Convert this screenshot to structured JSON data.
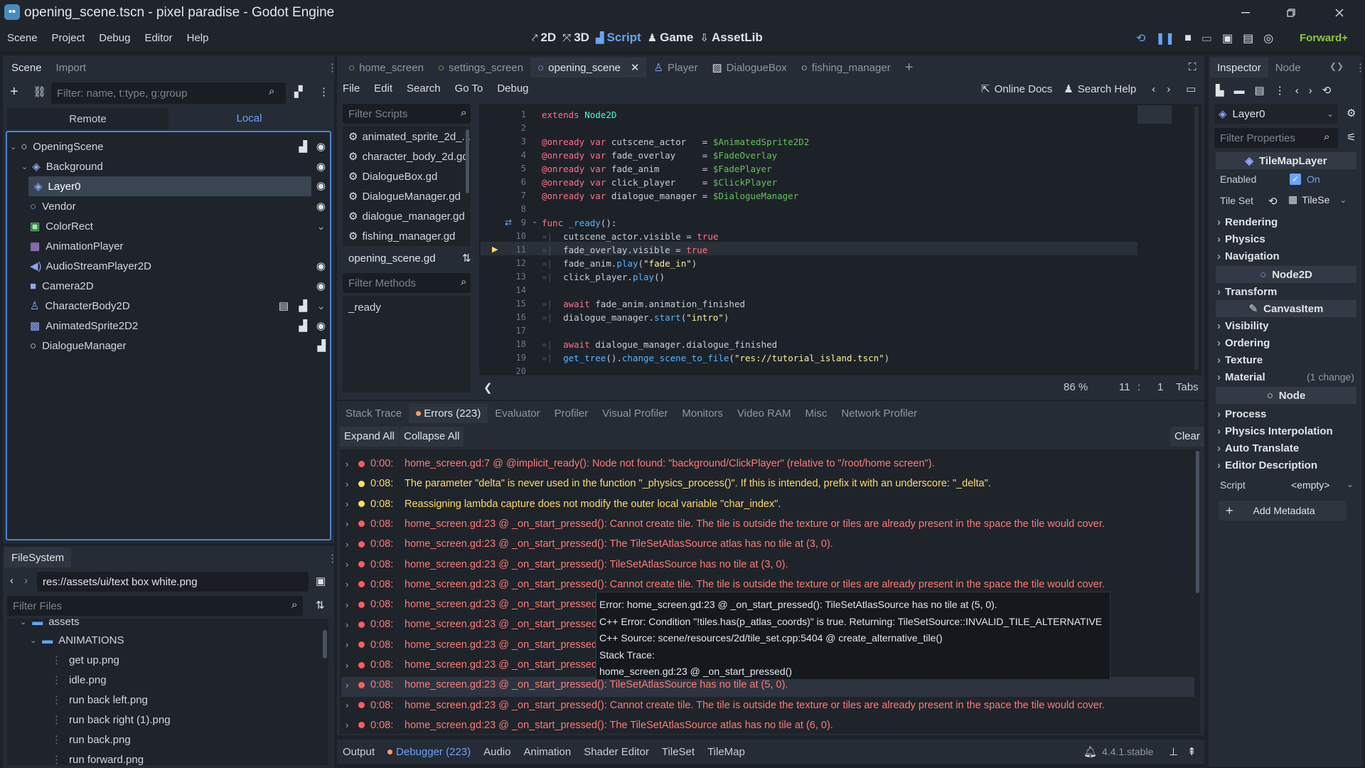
{
  "window": {
    "title": "opening_scene.tscn - pixel paradise - Godot Engine"
  },
  "menu": [
    "Scene",
    "Project",
    "Debug",
    "Editor",
    "Help"
  ],
  "workspaces": [
    {
      "label": "2D"
    },
    {
      "label": "3D"
    },
    {
      "label": "Script"
    },
    {
      "label": "Game"
    },
    {
      "label": "AssetLib"
    }
  ],
  "renderer": "Forward+",
  "scene_dock": {
    "tabs": [
      "Scene",
      "Import"
    ],
    "filter_placeholder": "Filter: name, t:type, g:group",
    "remote": "Remote",
    "local": "Local",
    "nodes": [
      "OpeningScene",
      "Background",
      "Layer0",
      "Vendor",
      "ColorRect",
      "AnimationPlayer",
      "AudioStreamPlayer2D",
      "Camera2D",
      "CharacterBody2D",
      "AnimatedSprite2D2",
      "DialogueManager"
    ]
  },
  "filesystem": {
    "tab": "FileSystem",
    "path": "res://assets/ui/text box white.png",
    "filter_placeholder": "Filter Files",
    "items": [
      "assets",
      "ANIMATIONS",
      "get up.png",
      "idle.png",
      "run back left.png",
      "run back right (1).png",
      "run back.png",
      "run forward.png"
    ]
  },
  "editor_tabs": [
    "home_screen",
    "settings_screen",
    "opening_scene",
    "Player",
    "DialogueBox",
    "fishing_manager"
  ],
  "script_menu": [
    "File",
    "Edit",
    "Search",
    "Go To",
    "Debug"
  ],
  "script_toolbar": {
    "online_docs": "Online Docs",
    "search_help": "Search Help"
  },
  "scripts": {
    "filter_placeholder": "Filter Scripts",
    "list": [
      "animated_sprite_2d_...",
      "character_body_2d.gd",
      "DialogueBox.gd",
      "DialogueManager.gd",
      "dialogue_manager.gd",
      "fishing_manager.gd"
    ],
    "current": "opening_scene.gd",
    "methods_placeholder": "Filter Methods",
    "methods": [
      "_ready"
    ]
  },
  "code_lines": [
    "1",
    "2",
    "3",
    "4",
    "5",
    "6",
    "7",
    "8",
    "9",
    "10",
    "11",
    "12",
    "13",
    "14",
    "15",
    "16",
    "17",
    "18",
    "19",
    "20"
  ],
  "status": {
    "zoom": "86 %",
    "line": "11",
    "col": "1",
    "indent": "Tabs"
  },
  "debugger": {
    "tabs": [
      "Stack Trace",
      "Errors (223)",
      "Evaluator",
      "Profiler",
      "Visual Profiler",
      "Monitors",
      "Video RAM",
      "Misc",
      "Network Profiler"
    ],
    "expand": "Expand All",
    "collapse": "Collapse All",
    "clear": "Clear",
    "errors": [
      {
        "time": "0:00:",
        "text": "home_screen.gd:7 @ @implicit_ready(): Node not found: \"background/ClickPlayer\" (relative to \"/root/home screen\").",
        "level": "error"
      },
      {
        "time": "0:08:",
        "text": "The parameter \"delta\" is never used in the function \"_physics_process()\". If this is intended, prefix it with an underscore: \"_delta\".",
        "level": "warning"
      },
      {
        "time": "0:08:",
        "text": "Reassigning lambda capture does not modify the outer local variable \"char_index\".",
        "level": "warning"
      },
      {
        "time": "0:08:",
        "text": "home_screen.gd:23 @ _on_start_pressed(): Cannot create tile. The tile is outside the texture or tiles are already present in the space the tile would cover.",
        "level": "error"
      },
      {
        "time": "0:08:",
        "text": "home_screen.gd:23 @ _on_start_pressed(): The TileSetAtlasSource atlas has no tile at (3, 0).",
        "level": "error"
      },
      {
        "time": "0:08:",
        "text": "home_screen.gd:23 @ _on_start_pressed(): TileSetAtlasSource has no tile at (3, 0).",
        "level": "error"
      },
      {
        "time": "0:08:",
        "text": "home_screen.gd:23 @ _on_start_pressed(): Cannot create tile. The tile is outside the texture or tiles are already present in the space the tile would cover.",
        "level": "error"
      },
      {
        "time": "0:08:",
        "text": "home_screen.gd:23 @ _on_start_pressed():",
        "level": "error"
      },
      {
        "time": "0:08:",
        "text": "home_screen.gd:23 @ _on_start_pressed():",
        "level": "error"
      },
      {
        "time": "0:08:",
        "text": "home_screen.gd:23 @ _on_start_pressed():",
        "level": "error"
      },
      {
        "time": "0:08:",
        "text": "home_screen.gd:23 @ _on_start_pressed():",
        "level": "error"
      },
      {
        "time": "0:08:",
        "text": "home_screen.gd:23 @ _on_start_pressed(): TileSetAtlasSource has no tile at (5, 0).",
        "level": "error"
      },
      {
        "time": "0:08:",
        "text": "home_screen.gd:23 @ _on_start_pressed(): Cannot create tile. The tile is outside the texture or tiles are already present in the space the tile would cover.",
        "level": "error"
      },
      {
        "time": "0:08:",
        "text": "home_screen.gd:23 @ _on_start_pressed(): The TileSetAtlasSource atlas has no tile at (6, 0).",
        "level": "error"
      }
    ],
    "tooltip": [
      "Error: home_screen.gd:23 @ _on_start_pressed(): TileSetAtlasSource has no tile at (5, 0).",
      "C++ Error: Condition \"!tiles.has(p_atlas_coords)\" is true. Returning: TileSetSource::INVALID_TILE_ALTERNATIVE",
      "C++ Source: scene/resources/2d/tile_set.cpp:5404 @ create_alternative_tile()",
      "Stack Trace:",
      "home_screen.gd:23 @ _on_start_pressed()"
    ]
  },
  "bottom_tabs": [
    "Output",
    "Debugger (223)",
    "Audio",
    "Animation",
    "Shader Editor",
    "TileSet",
    "TileMap"
  ],
  "version": "4.4.1.stable",
  "inspector": {
    "tabs": [
      "Inspector",
      "Node"
    ],
    "node": "Layer0",
    "filter_placeholder": "Filter Properties",
    "class": "TileMapLayer",
    "enabled_label": "Enabled",
    "enabled_value": "On",
    "tileset_label": "Tile Set",
    "tileset_value": "TileSe",
    "sections1": [
      "Rendering",
      "Physics",
      "Navigation"
    ],
    "class2": "Node2D",
    "sections2": [
      "Transform"
    ],
    "class3": "CanvasItem",
    "sections3": [
      "Visibility",
      "Ordering",
      "Texture",
      "Material"
    ],
    "material_note": "(1 change)",
    "class4": "Node",
    "sections4": [
      "Process",
      "Physics Interpolation",
      "Auto Translate",
      "Editor Description"
    ],
    "script_label": "Script",
    "script_value": "<empty>",
    "add_metadata": "Add Metadata"
  }
}
